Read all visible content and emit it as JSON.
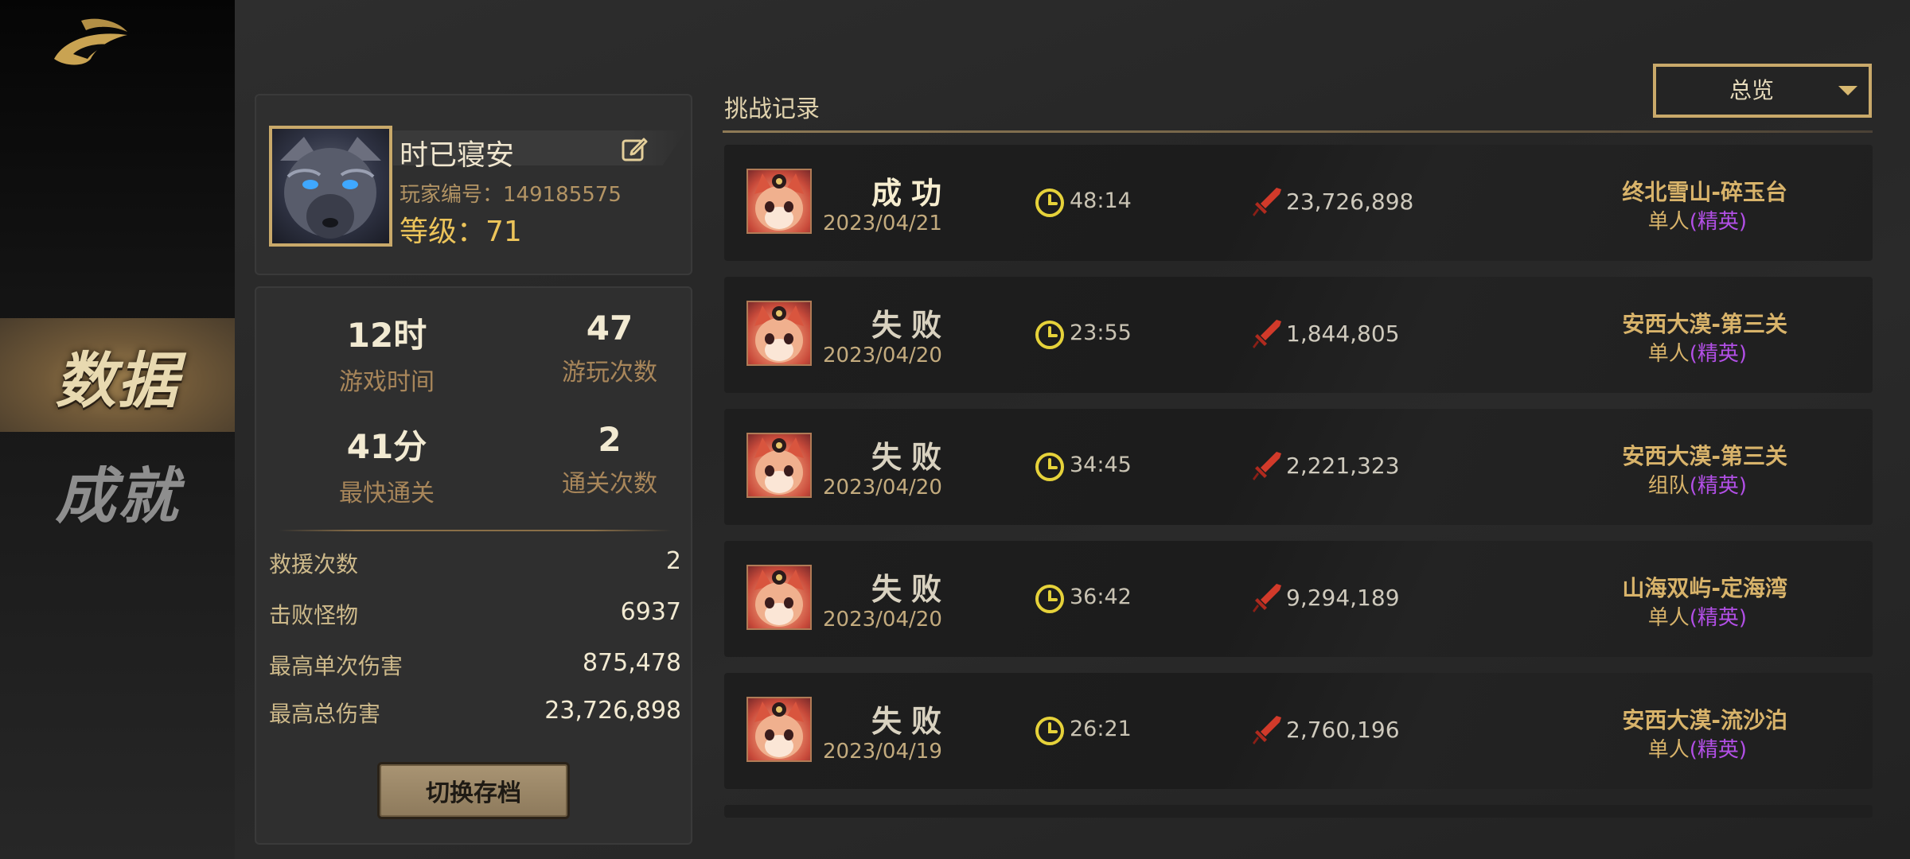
{
  "nav": {
    "items": [
      {
        "label": "数据",
        "active": true
      },
      {
        "label": "成就",
        "active": false
      }
    ]
  },
  "profile": {
    "name": "时已寝安",
    "id_text": "玩家编号：149185575",
    "level_text": "等级：71"
  },
  "stats": {
    "big": [
      {
        "value": "12时",
        "label": "游戏时间"
      },
      {
        "value": "47",
        "label": "游玩次数"
      },
      {
        "value": "41分",
        "label": "最快通关"
      },
      {
        "value": "2",
        "label": "通关次数"
      }
    ],
    "rows": [
      {
        "key": "救援次数",
        "value": "2"
      },
      {
        "key": "击败怪物",
        "value": "6937"
      },
      {
        "key": "最高单次伤害",
        "value": "875,478"
      },
      {
        "key": "最高总伤害",
        "value": "23,726,898"
      }
    ],
    "switch_label": "切换存档"
  },
  "records": {
    "title": "挑战记录",
    "filter": "总览",
    "items": [
      {
        "result": "成功",
        "win": true,
        "date": "2023/04/21",
        "time": "48:14",
        "damage": "23,726,898",
        "stage": "终北雪山-碎玉台",
        "mode": "单人",
        "difficulty": "(精英)"
      },
      {
        "result": "失败",
        "win": false,
        "date": "2023/04/20",
        "time": "23:55",
        "damage": "1,844,805",
        "stage": "安西大漠-第三关",
        "mode": "单人",
        "difficulty": "(精英)"
      },
      {
        "result": "失败",
        "win": false,
        "date": "2023/04/20",
        "time": "34:45",
        "damage": "2,221,323",
        "stage": "安西大漠-第三关",
        "mode": "组队",
        "difficulty": "(精英)"
      },
      {
        "result": "失败",
        "win": false,
        "date": "2023/04/20",
        "time": "36:42",
        "damage": "9,294,189",
        "stage": "山海双屿-定海湾",
        "mode": "单人",
        "difficulty": "(精英)"
      },
      {
        "result": "失败",
        "win": false,
        "date": "2023/04/19",
        "time": "26:21",
        "damage": "2,760,196",
        "stage": "安西大漠-流沙泊",
        "mode": "单人",
        "difficulty": "(精英)"
      }
    ]
  },
  "colors": {
    "gold": "#c9a96a",
    "elite": "#b24fe6",
    "stage": "#d8b36a"
  }
}
